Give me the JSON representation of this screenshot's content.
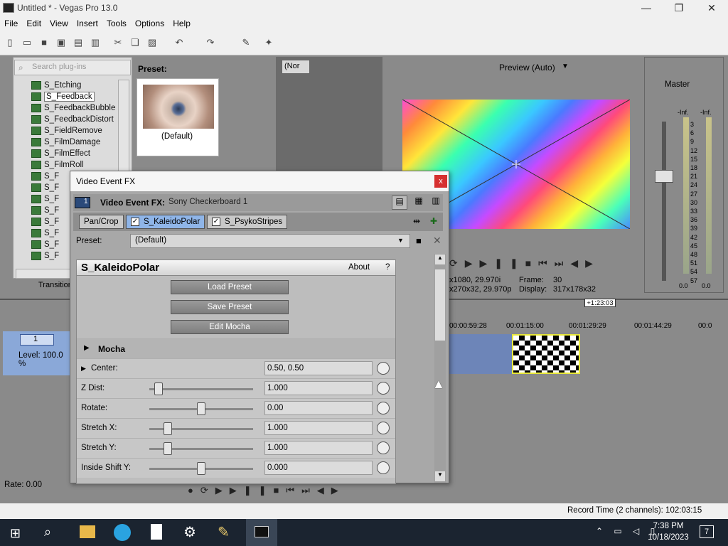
{
  "window": {
    "title": "Untitled * - Vegas Pro 13.0"
  },
  "menu": [
    "File",
    "Edit",
    "View",
    "Insert",
    "Tools",
    "Options",
    "Help"
  ],
  "explorer": {
    "search_placeholder": "Search plug-ins",
    "items": [
      "S_Etching",
      "S_Feedback",
      "S_FeedbackBubble",
      "S_FeedbackDistort",
      "S_FieldRemove",
      "S_FilmDamage",
      "S_FilmEffect",
      "S_FilmRoll",
      "S_F",
      "S_F",
      "S_F",
      "S_F",
      "S_F",
      "S_F",
      "S_F",
      "S_F"
    ],
    "selected_index": 1,
    "preset_label": "Preset:",
    "preset_thumb_caption": "(Default)",
    "tab_transitions": "Transition"
  },
  "preview_toolbar": {
    "mode": "Preview (Auto)",
    "combo": "(Nor"
  },
  "preview_info": {
    "line1_left": "x1080, 29.970i",
    "line1_right_label": "Frame:",
    "line1_right_value": "30",
    "line2_left": "x270x32, 29.970p",
    "line2_right_label": "Display:",
    "line2_right_value": "317x178x32"
  },
  "mixer": {
    "title": "Master",
    "left_db": "-Inf.",
    "right_db": "-Inf.",
    "scale": [
      "3",
      "6",
      "9",
      "12",
      "15",
      "18",
      "21",
      "24",
      "27",
      "30",
      "33",
      "36",
      "39",
      "42",
      "45",
      "48",
      "51",
      "54",
      "57"
    ],
    "bottom_left": "0.0",
    "bottom_right": "0.0"
  },
  "timeline": {
    "time_marker": "+1:23:03",
    "ruler": [
      "00:00:59:28",
      "00:01:15:00",
      "00:01:29:29",
      "00:01:44:29",
      "00:0"
    ]
  },
  "track": {
    "number": "1",
    "level": "Level: 100.0 %"
  },
  "rate": "Rate: 0.00",
  "status": {
    "record_time": "Record Time (2 channels): 102:03:15"
  },
  "dialog": {
    "title": "Video Event FX",
    "close": "x",
    "fx_label": "Video Event FX:",
    "fx_name": "Sony Checkerboard 1",
    "track_no": "1",
    "chain": [
      {
        "label": "Pan/Crop",
        "checked": false
      },
      {
        "label": "S_KaleidoPolar",
        "checked": true,
        "active": true
      },
      {
        "label": "S_PsykoStripes",
        "checked": true
      }
    ],
    "preset_label": "Preset:",
    "preset_value": "(Default)",
    "plugin": {
      "name": "S_KaleidoPolar",
      "about": "About",
      "help": "?",
      "buttons": [
        "Load Preset",
        "Save Preset",
        "Edit Mocha"
      ],
      "mocha_section": "Mocha",
      "params": [
        {
          "label": "Center:",
          "value": "0.50, 0.50",
          "expandable": true
        },
        {
          "label": "Z Dist:",
          "value": "1.000",
          "slider": 0.05
        },
        {
          "label": "Rotate:",
          "value": "0.00",
          "slider": 0.5
        },
        {
          "label": "Stretch X:",
          "value": "1.000",
          "slider": 0.15
        },
        {
          "label": "Stretch Y:",
          "value": "1.000",
          "slider": 0.15
        },
        {
          "label": "Inside Shift Y:",
          "value": "0.000",
          "slider": 0.5
        }
      ]
    }
  },
  "taskbar": {
    "time": "7:38 PM",
    "date": "10/18/2023",
    "notifications": "7"
  }
}
